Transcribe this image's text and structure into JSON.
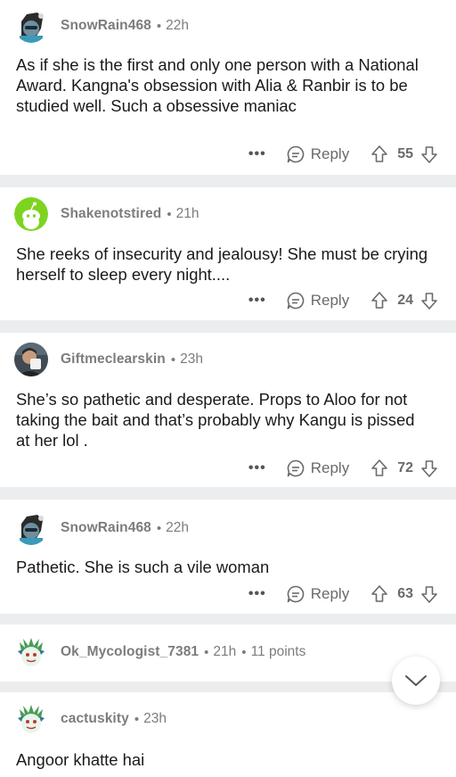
{
  "comments": [
    {
      "username": "SnowRain468",
      "time": "22h",
      "text": "As if she is the first and only one person with a National Award. Kangna's obsession with Alia & Ranbir is to be studied well. Such a obsessive maniac",
      "reply_label": "Reply",
      "score": "55",
      "avatar_icon": "snoo-dark-avatar-icon"
    },
    {
      "username": "Shakenotstired",
      "time": "21h",
      "text": "She reeks of insecurity and jealousy! She must be crying herself to sleep every night....",
      "reply_label": "Reply",
      "score": "24",
      "avatar_icon": "snoo-green-avatar-icon"
    },
    {
      "username": "Giftmeclearskin",
      "time": "23h",
      "text": "She’s so pathetic and desperate. Props to Aloo for not taking the bait and that’s probably why Kangu is pissed at her lol .",
      "reply_label": "Reply",
      "score": "72",
      "avatar_icon": "photo-avatar-icon"
    },
    {
      "username": "SnowRain468",
      "time": "22h",
      "text": "Pathetic. She  is such a vile woman",
      "reply_label": "Reply",
      "score": "63",
      "avatar_icon": "snoo-dark-avatar-icon"
    },
    {
      "username": "Ok_Mycologist_7381",
      "time": "21h",
      "points": "11 points",
      "avatar_icon": "snoo-dragon-avatar-icon"
    },
    {
      "username": "cactuskity",
      "time": "23h",
      "text": "Angoor khatte hai",
      "avatar_icon": "snoo-dragon-avatar-icon"
    }
  ],
  "more_options_label": "•••",
  "separator": "•",
  "scroll_icon": "chevron-down-icon",
  "colors": {
    "background": "#ebedef",
    "card": "#ffffff",
    "muted_text": "#7c7c7c",
    "body_text": "#1a1a1b"
  }
}
